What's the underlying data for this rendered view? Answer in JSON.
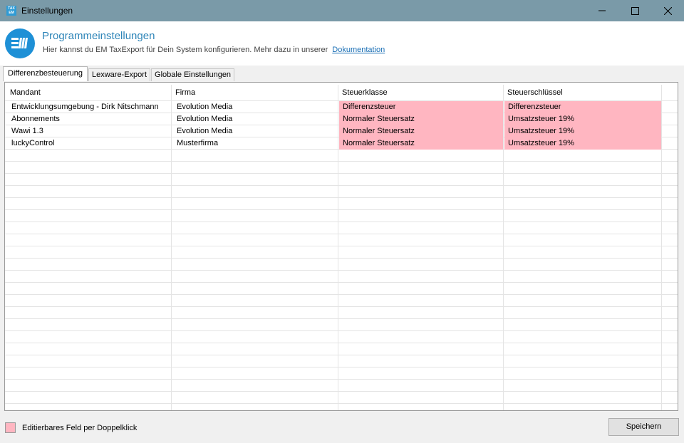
{
  "window": {
    "title": "Einstellungen",
    "app_icon_text": "TAX EM"
  },
  "header": {
    "title": "Programmeinstellungen",
    "subtitle": "Hier kannst du EM TaxExport für Dein System konfigurieren. Mehr dazu in unserer",
    "link": "Dokumentation",
    "brand_color": "#1e90d6"
  },
  "tabs": [
    {
      "label": "Differenzbesteuerung",
      "active": true
    },
    {
      "label": "Lexware-Export",
      "active": false
    },
    {
      "label": "Globale Einstellungen",
      "active": false
    }
  ],
  "grid": {
    "columns": [
      "Mandant",
      "Firma",
      "Steuerklasse",
      "Steuerschlüssel"
    ],
    "editable_color": "#ffb6c1",
    "rows": [
      [
        "Entwicklungsumgebung - Dirk Nitschmann",
        "Evolution Media",
        "Differenzsteuer",
        "Differenzsteuer"
      ],
      [
        "Abonnements",
        "Evolution Media",
        "Normaler Steuersatz",
        "Umsatzsteuer 19%"
      ],
      [
        "Wawi 1.3",
        "Evolution Media",
        "Normaler Steuersatz",
        "Umsatzsteuer 19%"
      ],
      [
        "luckyControl",
        "Musterfirma",
        "Normaler Steuersatz",
        "Umsatzsteuer 19%"
      ]
    ]
  },
  "footer": {
    "legend": "Editierbares Feld per Doppelklick",
    "save_label": "Speichern"
  }
}
